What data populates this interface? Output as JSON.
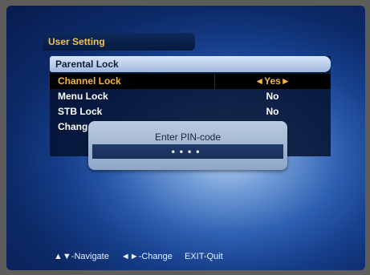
{
  "header": {
    "title": "User Setting"
  },
  "panel": {
    "title": "Parental Lock"
  },
  "rows": [
    {
      "label": "Channel Lock",
      "value": "◄Yes►",
      "selected": true
    },
    {
      "label": "Menu Lock",
      "value": "No",
      "selected": false
    },
    {
      "label": "STB Lock",
      "value": "No",
      "selected": false
    },
    {
      "label": "Chang",
      "value": "",
      "selected": false
    }
  ],
  "pin_dialog": {
    "title": "Enter PIN-code",
    "value": "••••"
  },
  "footer": {
    "navigate": "▲▼-Navigate",
    "change": "◄►-Change",
    "exit": "EXIT-Quit"
  },
  "colors": {
    "selected_text": "#f5b53a",
    "header_text": "#f0c050"
  }
}
